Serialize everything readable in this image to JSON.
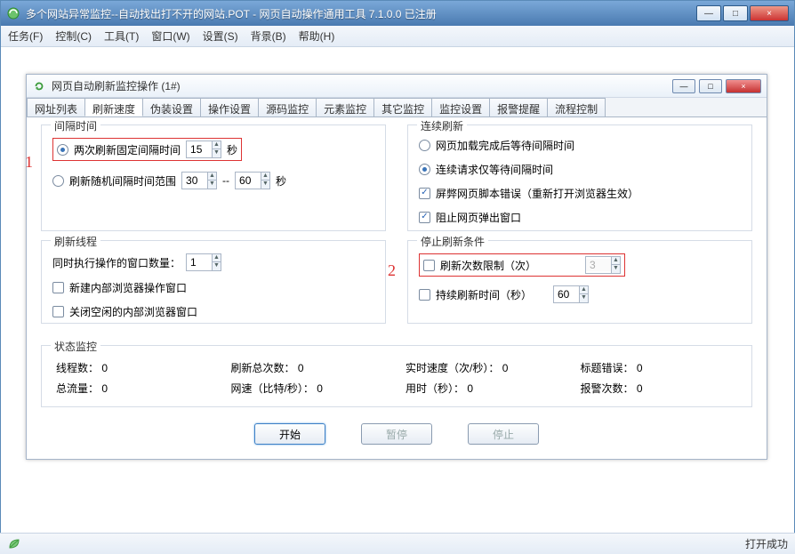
{
  "outer": {
    "title": "多个网站异常监控--自动找出打不开的网站.POT  -  网页自动操作通用工具  7.1.0.0  已注册",
    "winbtns": {
      "min": "—",
      "max": "□",
      "close": "×"
    }
  },
  "menus": [
    "任务(F)",
    "控制(C)",
    "工具(T)",
    "窗口(W)",
    "设置(S)",
    "背景(B)",
    "帮助(H)"
  ],
  "inner": {
    "title": "网页自动刷新监控操作  (1#)",
    "winbtns": {
      "min": "—",
      "max": "□",
      "close": "×"
    }
  },
  "tabs": [
    "网址列表",
    "刷新速度",
    "伪装设置",
    "操作设置",
    "源码监控",
    "元素监控",
    "其它监控",
    "监控设置",
    "报警提醒",
    "流程控制"
  ],
  "active_tab": 1,
  "interval_group": {
    "legend": "间隔时间",
    "radio1_label": "两次刷新固定间隔时间",
    "radio1_value": "15",
    "radio1_unit": "秒",
    "radio2_label": "刷新随机间隔时间范围",
    "radio2_from": "30",
    "radio2_sep": "--",
    "radio2_to": "60",
    "radio2_unit": "秒"
  },
  "continuous_group": {
    "legend": "连续刷新",
    "radio1": "网页加载完成后等待间隔时间",
    "radio2": "连续请求仅等待间隔时间",
    "check1": "屏弊网页脚本错误（重新打开浏览器生效）",
    "check2": "阻止网页弹出窗口"
  },
  "thread_group": {
    "legend": "刷新线程",
    "concurrent_label": "同时执行操作的窗口数量：",
    "concurrent_value": "1",
    "check1": "新建内部浏览器操作窗口",
    "check2": "关闭空闲的内部浏览器窗口"
  },
  "stop_group": {
    "legend": "停止刷新条件",
    "check1": "刷新次数限制（次）",
    "check1_value": "3",
    "check2": "持续刷新时间（秒）",
    "check2_value": "60"
  },
  "markers": {
    "one": "1",
    "two": "2"
  },
  "status_group": {
    "legend": "状态监控",
    "items": {
      "thread_count_label": "线程数：",
      "thread_count_value": "0",
      "total_refresh_label": "刷新总次数：",
      "total_refresh_value": "0",
      "speed_label": "实时速度（次/秒）：",
      "speed_value": "0",
      "title_err_label": "标题错误：",
      "title_err_value": "0",
      "traffic_label": "总流量：",
      "traffic_value": "0",
      "net_label": "网速（比特/秒）：",
      "net_value": "0",
      "elapsed_label": "用时（秒）：",
      "elapsed_value": "0",
      "alarm_label": "报警次数：",
      "alarm_value": "0"
    }
  },
  "buttons": {
    "start": "开始",
    "pause": "暂停",
    "stop": "停止"
  },
  "statusbar": {
    "text": "打开成功"
  }
}
